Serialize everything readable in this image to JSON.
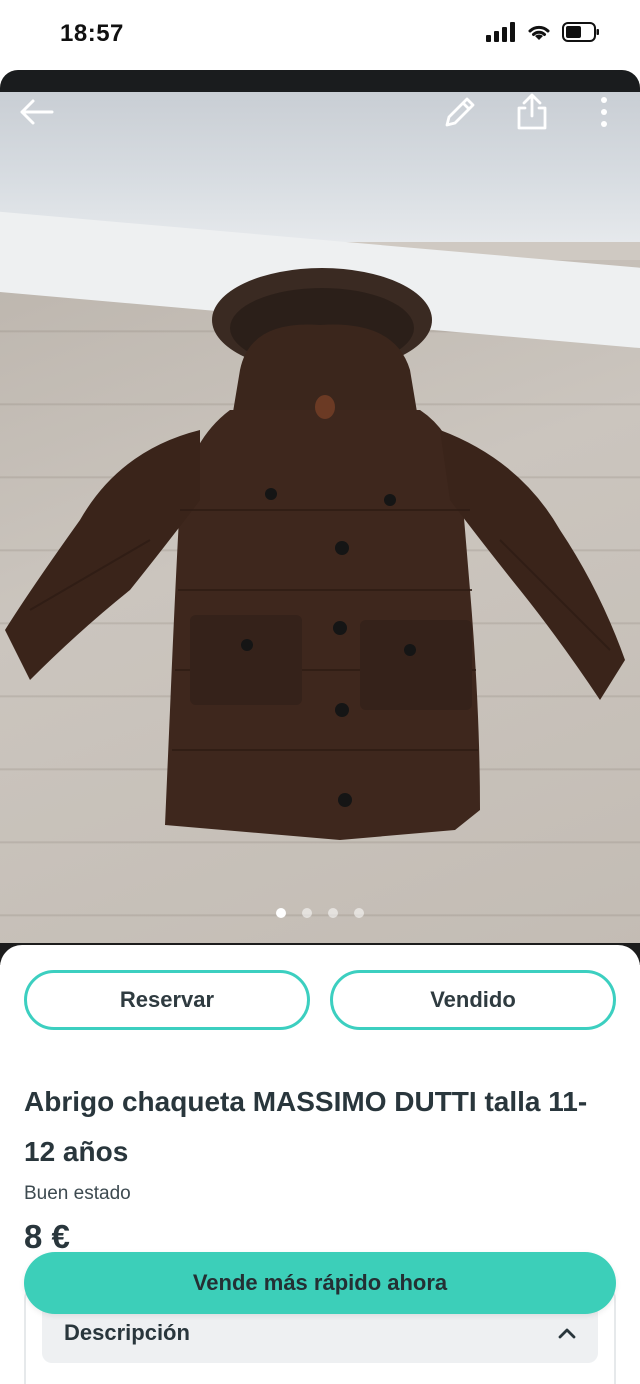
{
  "status_bar": {
    "time": "18:57"
  },
  "photo": {
    "image_count": 4,
    "active_index": 0
  },
  "actions": {
    "reserve_label": "Reservar",
    "sold_label": "Vendido"
  },
  "listing": {
    "title": "Abrigo chaqueta MASSIMO DUTTI talla 11-12 años",
    "condition": "Buen estado",
    "price": "8 €"
  },
  "description": {
    "heading": "Descripción"
  },
  "cta": {
    "label": "Vende más rápido ahora"
  },
  "colors": {
    "accent": "#3ccfc0",
    "cta_bg": "#3ccfb9",
    "text": "#29363c"
  },
  "icons": {
    "back": "arrow-left-icon",
    "edit": "pencil-icon",
    "share": "share-icon",
    "more": "more-vertical-icon",
    "chevron": "chevron-up-icon"
  }
}
